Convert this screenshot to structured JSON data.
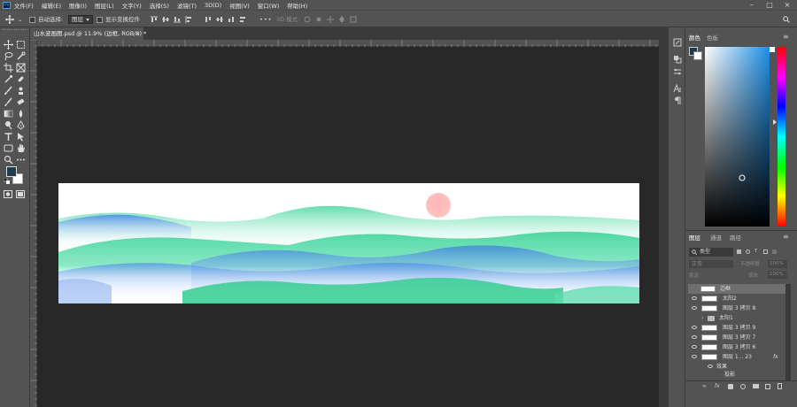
{
  "menu": {
    "items": [
      "文件(F)",
      "编辑(E)",
      "图像(I)",
      "图层(L)",
      "文字(Y)",
      "选择(S)",
      "滤镜(T)",
      "3D(D)",
      "视图(V)",
      "窗口(W)",
      "帮助(H)"
    ]
  },
  "options": {
    "auto_select_label": "自动选择:",
    "auto_select_value": "图层",
    "show_transform_label": "显示变换控件",
    "more_label": "•••",
    "mode_3d_label": "3D 模式:"
  },
  "document_tab": {
    "title": "山水波画图.psd @ 11.9% (边框, RGB/8) *",
    "close": "×"
  },
  "color_panel": {
    "tabs": [
      "颜色",
      "色板"
    ],
    "foreground_color": "#1f3a4d",
    "background_color": "#ffffff"
  },
  "layers_panel": {
    "tabs": [
      "图层",
      "通道",
      "路径"
    ],
    "kind_filter": "类型",
    "blend_mode": "正常",
    "opacity_label": "不透明度:",
    "opacity_value": "100%",
    "lock_label": "锁定:",
    "fill_label": "填充:",
    "fill_value": "100%",
    "layers": [
      {
        "name": "边框",
        "visible": false,
        "selected": true,
        "type": "layer"
      },
      {
        "name": "太阳2",
        "visible": true,
        "type": "layer"
      },
      {
        "name": "图层 3 拷贝 8",
        "visible": true,
        "type": "layer"
      },
      {
        "name": "太阳1",
        "visible": false,
        "type": "group"
      },
      {
        "name": "图层 3 拷贝 9",
        "visible": true,
        "type": "layer"
      },
      {
        "name": "图层 3 拷贝 7",
        "visible": true,
        "type": "layer"
      },
      {
        "name": "图层 3 拷贝 6",
        "visible": true,
        "type": "layer"
      },
      {
        "name": "图层 1... 23",
        "visible": true,
        "type": "layer",
        "fx": "fx"
      },
      {
        "name": "效果",
        "visible": true,
        "type": "effect"
      },
      {
        "name": "投影",
        "visible": true,
        "type": "effect-item"
      }
    ]
  }
}
